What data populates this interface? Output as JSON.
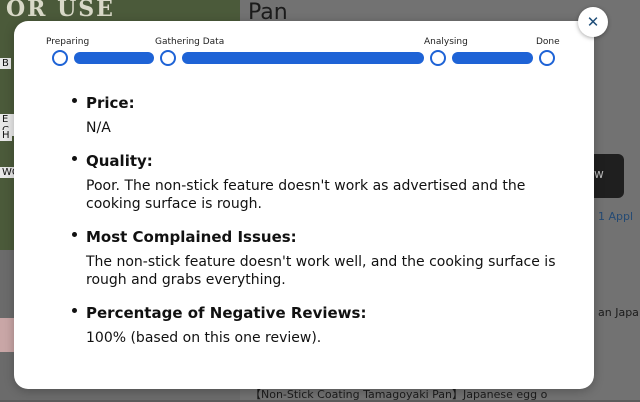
{
  "background": {
    "product_title": "Pan",
    "image_text": "OR USE",
    "side_letters": [
      "B",
      "E C",
      "H",
      "WC"
    ],
    "buy_button_label": "w",
    "apply_text": "1 Appl",
    "japan_text": "an Japa",
    "footer_text": "【Non-Stick Coating Tamagoyaki Pan】Japanese egg o"
  },
  "modal": {
    "close_symbol": "✕",
    "steps": [
      {
        "label": "Preparing"
      },
      {
        "label": "Gathering Data"
      },
      {
        "label": "Analysing"
      },
      {
        "label": "Done"
      }
    ],
    "items": [
      {
        "title": "Price:",
        "text": "N/A"
      },
      {
        "title": "Quality:",
        "text": "Poor. The non-stick feature doesn't work as advertised and the cooking surface is rough."
      },
      {
        "title": "Most Complained Issues:",
        "text": "The non-stick feature doesn't work well, and the cooking surface is rough and grabs everything."
      },
      {
        "title": "Percentage of Negative Reviews:",
        "text": "100% (based on this one review)."
      }
    ]
  },
  "colors": {
    "accent": "#1e63d6",
    "close_icon": "#1f4e79"
  }
}
